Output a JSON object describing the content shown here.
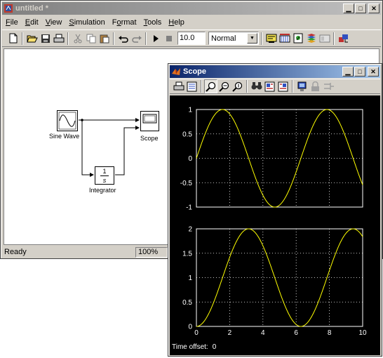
{
  "model_window": {
    "title": "untitled *",
    "menu": [
      {
        "accel": "F",
        "rest": "ile"
      },
      {
        "accel": "E",
        "rest": "dit"
      },
      {
        "accel": "V",
        "rest": "iew"
      },
      {
        "accel": "S",
        "rest": "imulation"
      },
      {
        "accel": "",
        "rest": "Format",
        "mid_accel": "o"
      },
      {
        "accel": "T",
        "rest": "ools"
      },
      {
        "accel": "H",
        "rest": "elp"
      }
    ],
    "menu_labels": [
      "File",
      "Edit",
      "View",
      "Simulation",
      "Format",
      "Tools",
      "Help"
    ],
    "stop_time": "10.0",
    "sim_mode": "Normal",
    "status": "Ready",
    "zoom": "100%",
    "blocks": {
      "sine_wave": "Sine Wave",
      "scope": "Scope",
      "integrator": "Integrator",
      "integrator_num": "1",
      "integrator_den": "s"
    }
  },
  "scope_window": {
    "title": "Scope",
    "time_offset_label": "Time offset:",
    "time_offset_value": "0"
  },
  "chart_data": [
    {
      "type": "line",
      "title": "",
      "xlabel": "",
      "ylabel": "",
      "xlim": [
        0,
        10
      ],
      "ylim": [
        -1,
        1
      ],
      "yticks": [
        "1",
        "0.5",
        "0",
        "-0.5",
        "-1"
      ],
      "grid": true,
      "series": [
        {
          "function": "sin(t)",
          "color": "#ffff00"
        }
      ]
    },
    {
      "type": "line",
      "title": "",
      "xlabel": "",
      "ylabel": "",
      "xlim": [
        0,
        10
      ],
      "ylim": [
        0,
        2
      ],
      "yticks": [
        "2",
        "1.5",
        "1",
        "0.5",
        "0"
      ],
      "xticks": [
        "0",
        "2",
        "4",
        "6",
        "8",
        "10"
      ],
      "grid": true,
      "series": [
        {
          "function": "1 - cos(t)",
          "color": "#ffff00"
        }
      ]
    }
  ],
  "colors": {
    "scope_bg": "#000000",
    "plot_trace": "#ffff00",
    "active_title": "#0a246a",
    "window_face": "#d4d0c8"
  },
  "icons": {
    "model_toolbar": [
      "new-icon",
      "open-icon",
      "save-icon",
      "print-icon",
      "cut-icon",
      "copy-icon",
      "paste-icon",
      "undo-icon",
      "redo-icon",
      "start-icon",
      "stop-icon",
      "build-icon",
      "update-icon",
      "debug-icon",
      "library-icon",
      "explorer-icon",
      "model-browser-icon"
    ],
    "scope_toolbar": [
      "print-icon",
      "parameters-icon",
      "zoom-icon",
      "zoom-x-icon",
      "zoom-y-icon",
      "autoscale-icon",
      "save-axes-icon",
      "restore-axes-icon",
      "floating-scope-icon",
      "lock-axes-icon",
      "signal-selector-icon"
    ]
  }
}
